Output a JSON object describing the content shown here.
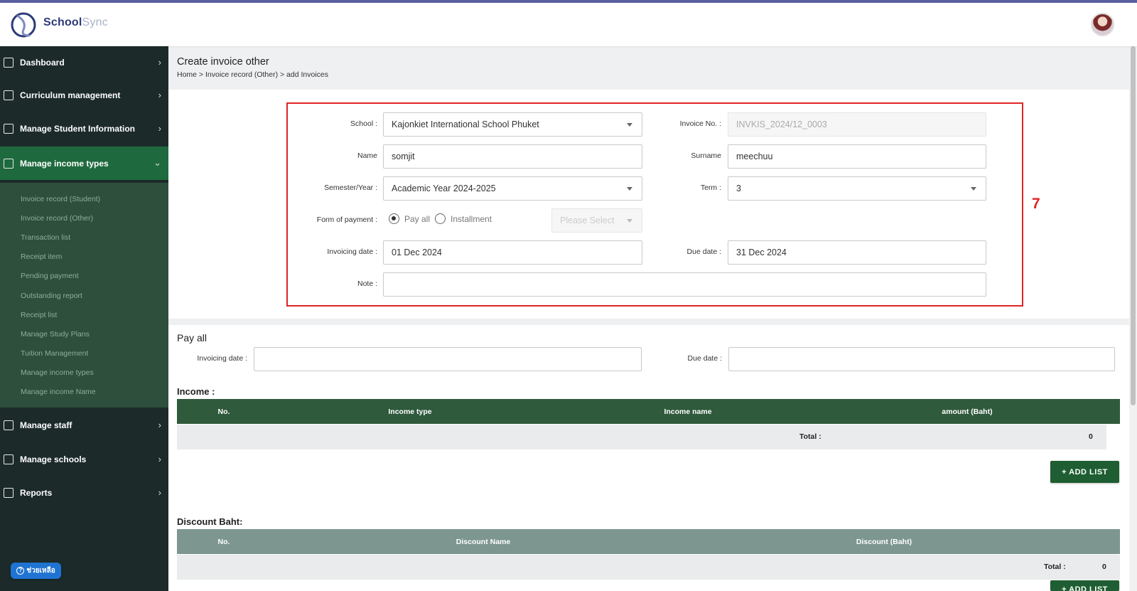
{
  "app": {
    "name_part1": "School",
    "name_part2": "Sync"
  },
  "sidebar": {
    "items": [
      {
        "label": "Dashboard",
        "icon": "grid-icon"
      },
      {
        "label": "Curriculum management",
        "icon": "graduation-cap-icon"
      },
      {
        "label": "Manage Student Information",
        "icon": "student-icon"
      },
      {
        "label": "Manage income types",
        "icon": "income-icon",
        "active": true
      },
      {
        "label": "Manage staff",
        "icon": "id-card-icon"
      },
      {
        "label": "Manage schools",
        "icon": "school-icon"
      },
      {
        "label": "Reports",
        "icon": "clipboard-icon"
      }
    ],
    "submenu": [
      "Invoice record (Student)",
      "Invoice record (Other)",
      "Transaction list",
      "Receipt item",
      "Pending payment",
      "Outstanding report",
      "Receipt list",
      "Manage Study Plans",
      "Tuition Management",
      "Manage income types",
      "Manage income Name"
    ]
  },
  "help": {
    "label": "ช่วยเหลือ"
  },
  "page": {
    "title": "Create invoice other",
    "breadcrumb": "Home > Invoice record (Other) > add Invoices"
  },
  "annotation": {
    "step": "7"
  },
  "form": {
    "school_label": "School :",
    "school_value": "Kajonkiet International School Phuket",
    "invoice_no_label": "Invoice No. :",
    "invoice_no_value": "INVKIS_2024/12_0003",
    "name_label": "Name",
    "name_value": "somjit",
    "surname_label": "Surname",
    "surname_value": "meechuu",
    "semester_label": "Semester/Year :",
    "semester_value": "Academic Year 2024-2025",
    "term_label": "Term :",
    "term_value": "3",
    "payment_label": "Form of payment :",
    "payment_options": [
      "Pay all",
      "Installment"
    ],
    "payment_selected": "Pay all",
    "installment_placeholder": "Please Select",
    "invoicing_date_label": "Invoicing date :",
    "invoicing_date_value": "01 Dec 2024",
    "due_date_label": "Due date :",
    "due_date_value": "31 Dec 2024",
    "note_label": "Note :",
    "note_value": ""
  },
  "pay_all": {
    "title": "Pay all",
    "invoicing_date_label": "Invoicing date :",
    "invoicing_date_value": "",
    "due_date_label": "Due date :",
    "due_date_value": ""
  },
  "income": {
    "title": "Income :",
    "columns": [
      "No.",
      "Income type",
      "Income name",
      "amount (Baht)"
    ],
    "rows": [],
    "total_label": "Total :",
    "total_value": "0",
    "add_button": "+ ADD LIST"
  },
  "discount": {
    "title": "Discount Baht:",
    "columns": [
      "No.",
      "Discount Name",
      "Discount (Baht)"
    ],
    "rows": [],
    "total_label": "Total :",
    "total_value": "0",
    "add_button": "+ ADD LIST"
  },
  "colors": {
    "sidebar": "#1c2b2a",
    "active": "#1e6a3e",
    "table_header": "#2f5a3c",
    "annotation": "#e02424"
  }
}
